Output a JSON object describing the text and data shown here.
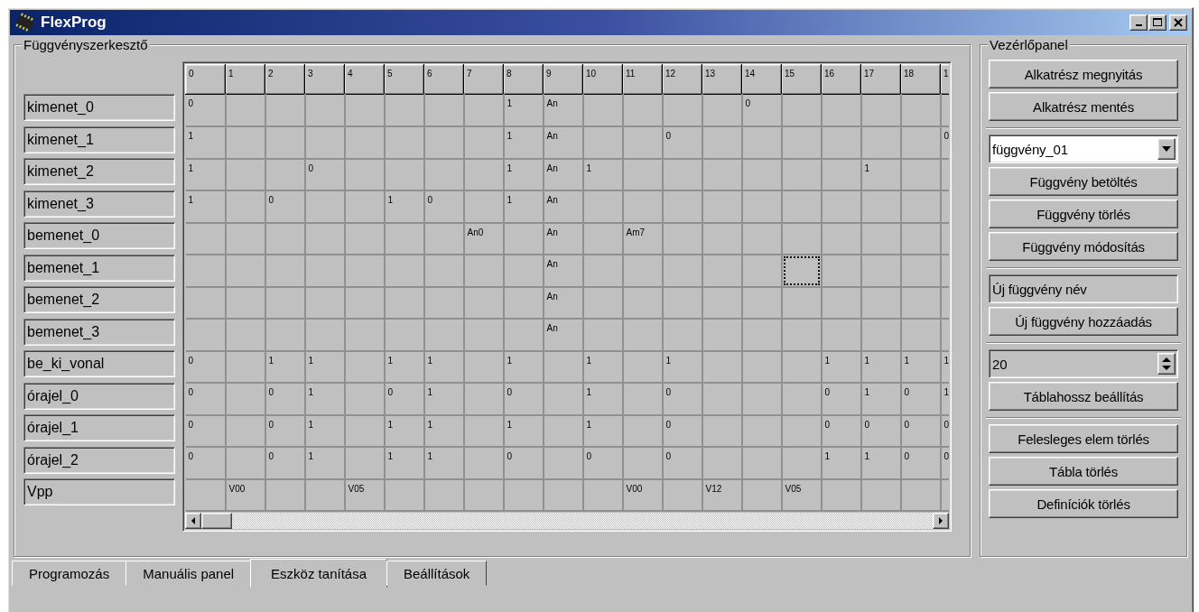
{
  "window": {
    "title": "FlexProg"
  },
  "editor": {
    "title": "Függvényszerkesztő",
    "columns": [
      "0",
      "1",
      "2",
      "3",
      "4",
      "5",
      "6",
      "7",
      "8",
      "9",
      "10",
      "11",
      "12",
      "13",
      "14",
      "15",
      "16",
      "17",
      "18",
      "1"
    ],
    "rows": [
      {
        "label": "kimenet_0",
        "cells": [
          "0",
          null,
          null,
          null,
          null,
          null,
          null,
          null,
          "1",
          "An",
          null,
          null,
          null,
          null,
          "0",
          null,
          null,
          null,
          null,
          null
        ]
      },
      {
        "label": "kimenet_1",
        "cells": [
          "1",
          null,
          null,
          null,
          null,
          null,
          null,
          null,
          "1",
          "An",
          null,
          null,
          "0",
          null,
          null,
          null,
          null,
          null,
          null,
          "0"
        ]
      },
      {
        "label": "kimenet_2",
        "cells": [
          "1",
          null,
          null,
          "0",
          null,
          null,
          null,
          null,
          "1",
          "An",
          "1",
          null,
          null,
          null,
          null,
          null,
          null,
          "1",
          null,
          null
        ]
      },
      {
        "label": "kimenet_3",
        "cells": [
          "1",
          null,
          "0",
          null,
          null,
          "1",
          "0",
          null,
          "1",
          "An",
          null,
          null,
          null,
          null,
          null,
          null,
          null,
          null,
          null,
          null
        ]
      },
      {
        "label": "bemenet_0",
        "cells": [
          null,
          null,
          null,
          null,
          null,
          null,
          null,
          "An0",
          null,
          "An",
          null,
          "Am7",
          null,
          null,
          null,
          null,
          null,
          null,
          null,
          null
        ]
      },
      {
        "label": "bemenet_1",
        "cells": [
          null,
          null,
          null,
          null,
          null,
          null,
          null,
          null,
          null,
          "An",
          null,
          null,
          null,
          null,
          null,
          {
            "focused": true
          },
          null,
          null,
          null,
          null
        ]
      },
      {
        "label": "bemenet_2",
        "cells": [
          null,
          null,
          null,
          null,
          null,
          null,
          null,
          null,
          null,
          "An",
          null,
          null,
          null,
          null,
          null,
          null,
          null,
          null,
          null,
          null
        ]
      },
      {
        "label": "bemenet_3",
        "cells": [
          null,
          null,
          null,
          null,
          null,
          null,
          null,
          null,
          null,
          "An",
          null,
          null,
          null,
          null,
          null,
          null,
          null,
          null,
          null,
          null
        ]
      },
      {
        "label": "be_ki_vonal",
        "cells": [
          "0",
          null,
          "1",
          "1",
          null,
          "1",
          "1",
          null,
          "1",
          null,
          "1",
          null,
          "1",
          null,
          null,
          null,
          "1",
          "1",
          "1",
          "1"
        ]
      },
      {
        "label": "órajel_0",
        "cells": [
          "0",
          null,
          "0",
          "1",
          null,
          "0",
          "1",
          null,
          "0",
          null,
          "1",
          null,
          "0",
          null,
          null,
          null,
          "0",
          "1",
          "0",
          "1"
        ]
      },
      {
        "label": "órajel_1",
        "cells": [
          "0",
          null,
          "0",
          "1",
          null,
          "1",
          "1",
          null,
          "1",
          null,
          "1",
          null,
          "0",
          null,
          null,
          null,
          "0",
          "0",
          "0",
          "0"
        ]
      },
      {
        "label": "órajel_2",
        "cells": [
          "0",
          null,
          "0",
          "1",
          null,
          "1",
          "1",
          null,
          "0",
          null,
          "0",
          null,
          "0",
          null,
          null,
          null,
          "1",
          "1",
          "0",
          "0"
        ]
      },
      {
        "label": "Vpp",
        "cells": [
          null,
          "V00",
          null,
          null,
          "V05",
          null,
          null,
          null,
          null,
          null,
          null,
          "V00",
          null,
          "V12",
          null,
          "V05",
          null,
          null,
          null,
          null
        ]
      }
    ]
  },
  "control_panel": {
    "title": "Vezérlőpanel",
    "groups": [
      [
        {
          "kind": "button",
          "label": "Alkatrész megnyitás"
        },
        {
          "kind": "button",
          "label": "Alkatrész mentés"
        }
      ],
      [
        {
          "kind": "dropdown",
          "value": "függvény_01"
        },
        {
          "kind": "button",
          "label": "Függvény betöltés"
        },
        {
          "kind": "button",
          "label": "Függvény törlés"
        },
        {
          "kind": "button",
          "label": "Függvény módosítás"
        }
      ],
      [
        {
          "kind": "text",
          "value": "Új függvény név"
        },
        {
          "kind": "button",
          "label": "Új függvény hozzáadás"
        }
      ],
      [
        {
          "kind": "spin",
          "value": "20"
        },
        {
          "kind": "button",
          "label": "Táblahossz beállítás"
        }
      ],
      [
        {
          "kind": "button",
          "label": "Felesleges elem törlés"
        },
        {
          "kind": "button",
          "label": "Tábla törlés"
        },
        {
          "kind": "button",
          "label": "Definíciók törlés"
        }
      ]
    ]
  },
  "tabs": [
    {
      "label": "Programozás",
      "selected": false
    },
    {
      "label": "Manuális panel",
      "selected": false
    },
    {
      "label": "Eszköz tanítása",
      "selected": true
    },
    {
      "label": "Beállítások",
      "selected": false
    }
  ]
}
